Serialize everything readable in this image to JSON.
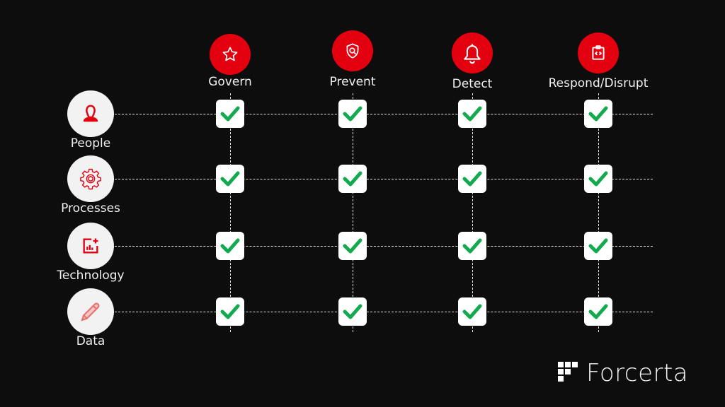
{
  "columns": [
    {
      "label": "Govern",
      "icon": "star-icon"
    },
    {
      "label": "Prevent",
      "icon": "shield-search-icon"
    },
    {
      "label": "Detect",
      "icon": "bell-icon"
    },
    {
      "label": "Respond/Disrupt",
      "icon": "clipboard-code-icon"
    }
  ],
  "rows": [
    {
      "label": "People",
      "icon": "person-icon"
    },
    {
      "label": "Processes",
      "icon": "gear-icon"
    },
    {
      "label": "Technology",
      "icon": "chart-add-icon"
    },
    {
      "label": "Data",
      "icon": "pencil-icon"
    }
  ],
  "matrix": [
    [
      true,
      true,
      true,
      true
    ],
    [
      true,
      true,
      true,
      true
    ],
    [
      true,
      true,
      true,
      true
    ],
    [
      true,
      true,
      true,
      true
    ]
  ],
  "colors": {
    "accent": "#e3000f",
    "check": "#12a94f",
    "background": "#0d0d0d"
  },
  "logo": {
    "text": "Forcerta"
  }
}
